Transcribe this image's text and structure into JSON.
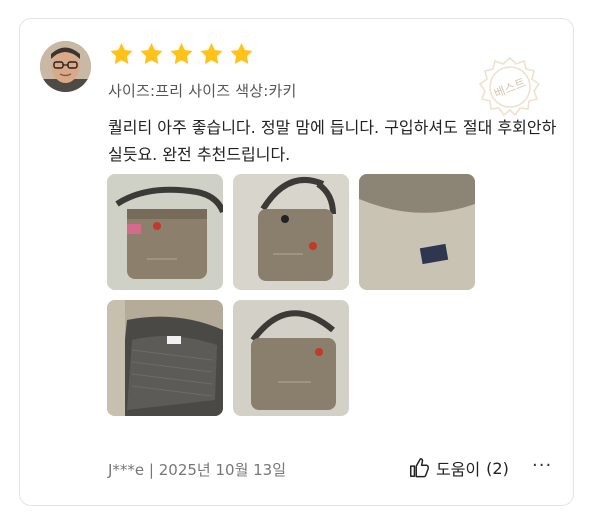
{
  "review": {
    "rating": 5,
    "options_text": "사이즈:프리 사이즈 색상:카키",
    "badge_label": "베스트",
    "text": "퀄리티 아주 좋습니다. 정말 맘에 듭니다. 구입하셔도 절대 후회안하실듯요. 완전 추천드립니다.",
    "author": "J***e",
    "date": "2025년 10월 13일",
    "author_line": "J***e | 2025년 10월 13일",
    "helpful_label": "도움이",
    "helpful_count": "(2)",
    "more_label": "···"
  },
  "photos": [
    {
      "name": "review-photo-1"
    },
    {
      "name": "review-photo-2"
    },
    {
      "name": "review-photo-3"
    },
    {
      "name": "review-photo-4"
    },
    {
      "name": "review-photo-5"
    }
  ],
  "colors": {
    "star": "#FFC21A",
    "bag": "#8c7f6c",
    "strap": "#3c3a36",
    "border": "#e4e4e4"
  }
}
